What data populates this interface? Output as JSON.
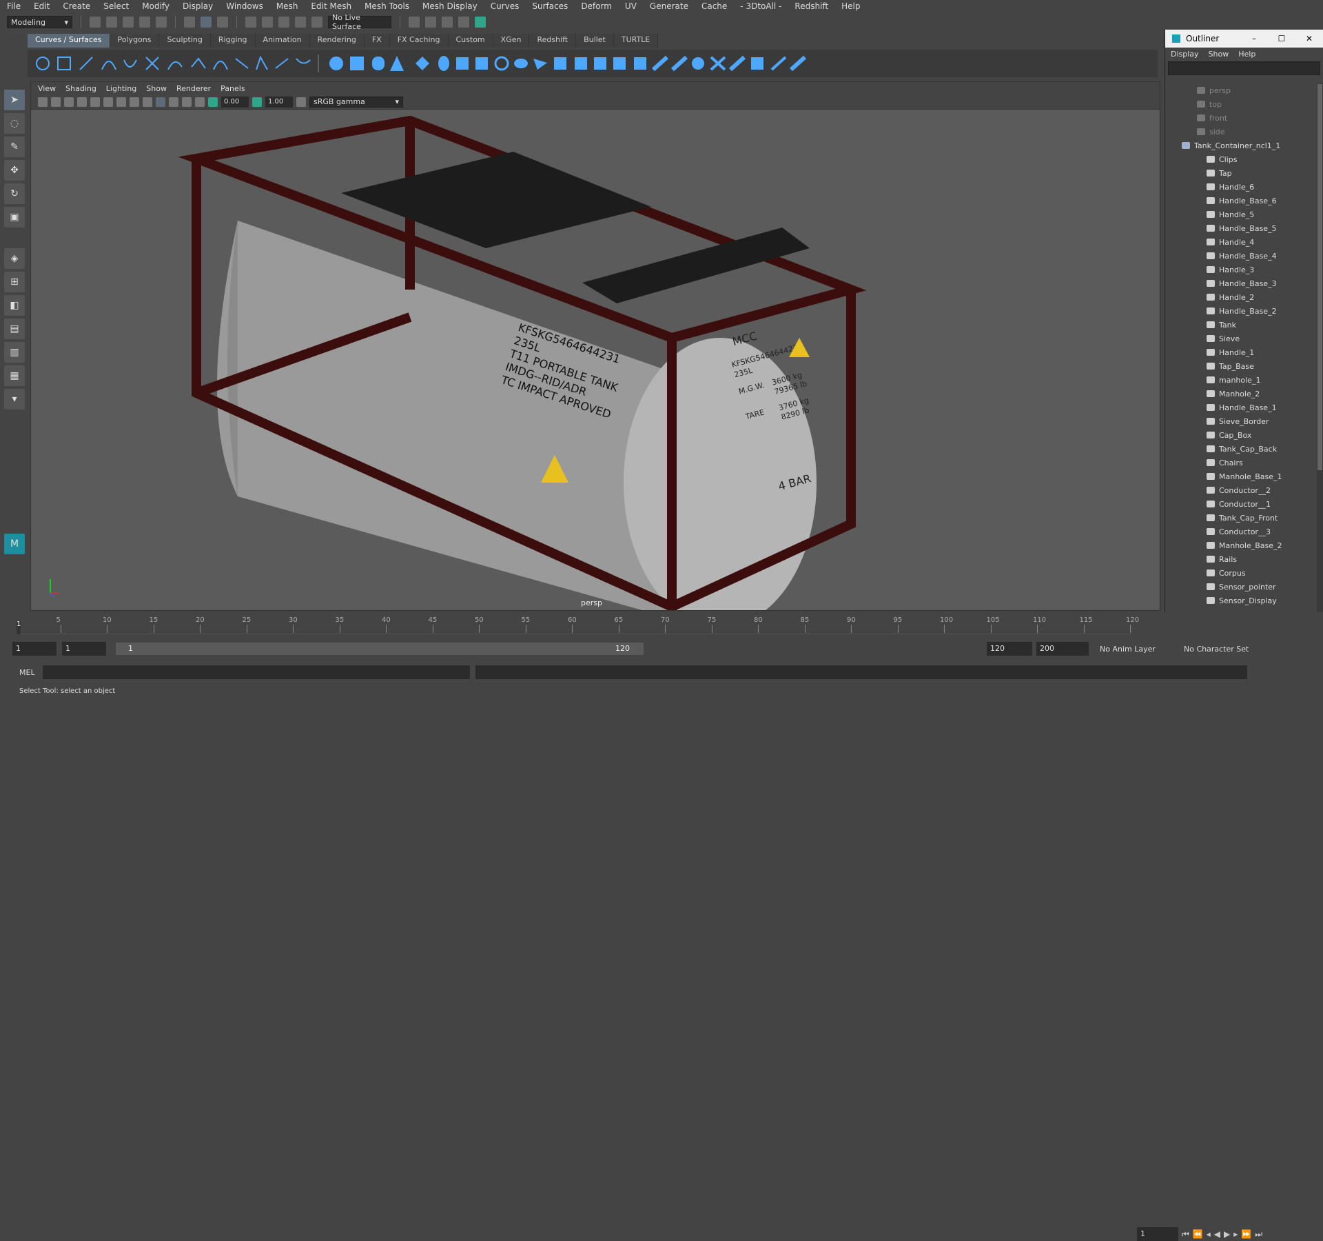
{
  "menubar": [
    "File",
    "Edit",
    "Create",
    "Select",
    "Modify",
    "Display",
    "Windows",
    "Mesh",
    "Edit Mesh",
    "Mesh Tools",
    "Mesh Display",
    "Curves",
    "Surfaces",
    "Deform",
    "UV",
    "Generate",
    "Cache",
    "- 3DtoAll -",
    "Redshift",
    "Help"
  ],
  "status": {
    "mode": "Modeling",
    "live_surface": "No Live Surface"
  },
  "shelf_tabs": [
    "Curves / Surfaces",
    "Polygons",
    "Sculpting",
    "Rigging",
    "Animation",
    "Rendering",
    "FX",
    "FX Caching",
    "Custom",
    "XGen",
    "Redshift",
    "Bullet",
    "TURTLE"
  ],
  "viewport": {
    "menu": [
      "View",
      "Shading",
      "Lighting",
      "Show",
      "Renderer",
      "Panels"
    ],
    "exposure": "0.00",
    "gamma": "1.00",
    "colorspace": "sRGB gamma",
    "camera_label": "persp"
  },
  "scene_text": {
    "line1": "KFSKG5464644231",
    "line2": "235L",
    "line3": "T11 PORTABLE TANK",
    "line4": "IMDG--RID/ADR",
    "line5": "TC IMPACT APROVED",
    "end1": "MCC",
    "end2": "KFSKG5464644231",
    "end3": "235L",
    "end4": "M.G.W.",
    "end5": "3600 kg",
    "end6": "79365 lb",
    "end7": "TARE",
    "end8": "3760 kg",
    "end9": "8290 lb",
    "end10": "4 BAR"
  },
  "outliner": {
    "title": "Outliner",
    "menu": [
      "Display",
      "Show",
      "Help"
    ],
    "cameras": [
      "persp",
      "top",
      "front",
      "side"
    ],
    "root": "Tank_Container_ncl1_1",
    "items": [
      "Clips",
      "Tap",
      "Handle_6",
      "Handle_Base_6",
      "Handle_5",
      "Handle_Base_5",
      "Handle_4",
      "Handle_Base_4",
      "Handle_3",
      "Handle_Base_3",
      "Handle_2",
      "Handle_Base_2",
      "Tank",
      "Sieve",
      "Handle_1",
      "Tap_Base",
      "manhole_1",
      "Manhole_2",
      "Handle_Base_1",
      "Sieve_Border",
      "Cap_Box",
      "Tank_Cap_Back",
      "Chairs",
      "Manhole_Base_1",
      "Conductor__2",
      "Conductor__1",
      "Tank_Cap_Front",
      "Conductor__3",
      "Manhole_Base_2",
      "Rails",
      "Corpus",
      "Sensor_pointer",
      "Sensor_Display"
    ]
  },
  "timeline": {
    "ticks": [
      "5",
      "10",
      "15",
      "20",
      "25",
      "30",
      "35",
      "40",
      "45",
      "50",
      "55",
      "60",
      "65",
      "70",
      "75",
      "80",
      "85",
      "90",
      "95",
      "100",
      "105",
      "110",
      "115",
      "120"
    ],
    "current": "1",
    "first": "1"
  },
  "range": {
    "start": "1",
    "start2": "1",
    "slider_start": "1",
    "slider_end": "120",
    "end": "120",
    "max": "200",
    "anim_layer": "No Anim Layer",
    "char_set": "No Character Set"
  },
  "cmd": {
    "label": "MEL"
  },
  "help": "Select Tool: select an object"
}
